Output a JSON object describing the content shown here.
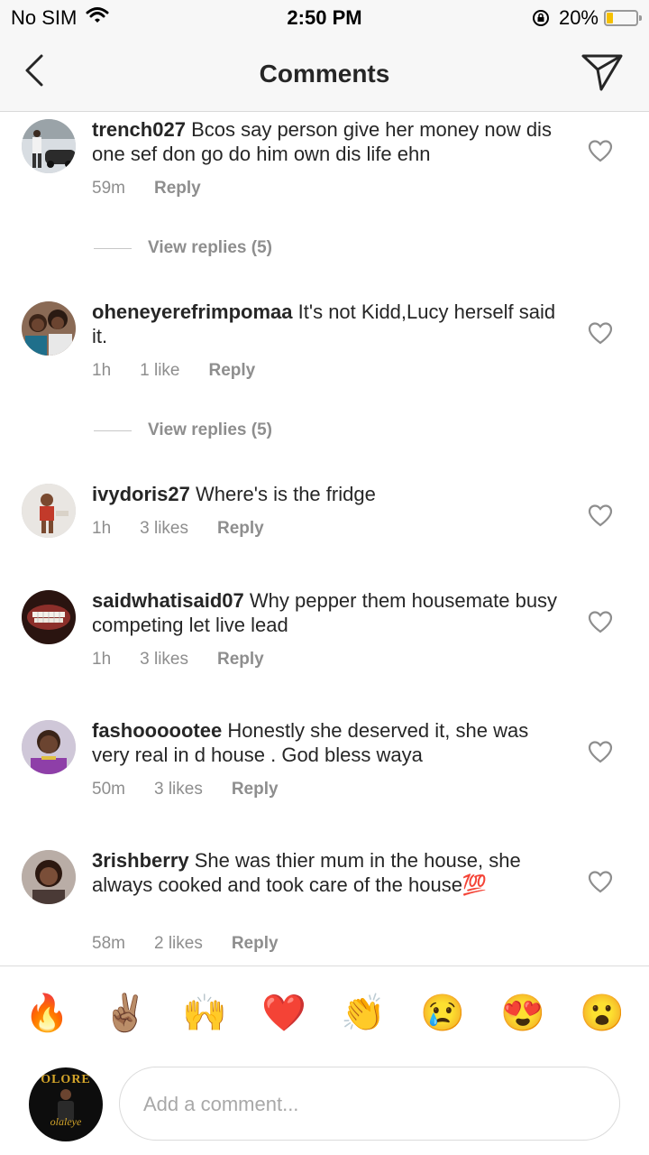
{
  "status_bar": {
    "carrier": "No SIM",
    "time": "2:50 PM",
    "battery": "20%"
  },
  "header": {
    "title": "Comments"
  },
  "comments": [
    {
      "username": "trench027",
      "text": "Bcos say person give her money now dis one sef don go do him own dis life ehn",
      "time": "59m",
      "likes": "",
      "reply": "Reply"
    },
    {
      "username": "oheneyerefrimpomaa",
      "text": "It's not Kidd,Lucy herself said it.",
      "time": "1h",
      "likes": "1 like",
      "reply": "Reply"
    },
    {
      "username": "ivydoris27",
      "text": "Where's is the fridge",
      "time": "1h",
      "likes": "3 likes",
      "reply": "Reply"
    },
    {
      "username": "saidwhatisaid07",
      "text": "Why pepper them housemate busy competing  let live lead",
      "time": "1h",
      "likes": "3 likes",
      "reply": "Reply"
    },
    {
      "username": "fashoooootee",
      "text": "Honestly she deserved it, she was very real in d house . God bless waya",
      "time": "50m",
      "likes": "3 likes",
      "reply": "Reply"
    },
    {
      "username": "3rishberry",
      "text": "She was thier mum in the house, she  always cooked and took care of the house💯",
      "time": "58m",
      "likes": "2 likes",
      "reply": "Reply"
    }
  ],
  "view_replies": [
    "View replies (5)",
    "View replies (5)"
  ],
  "emoji_bar": [
    "🔥",
    "✌🏽",
    "🙌",
    "❤️",
    "👏",
    "😢",
    "😍",
    "😮"
  ],
  "self_avatar": {
    "logo_text": "OLORE",
    "script_text": "olaleye"
  },
  "comment_input": {
    "placeholder": "Add a comment..."
  }
}
